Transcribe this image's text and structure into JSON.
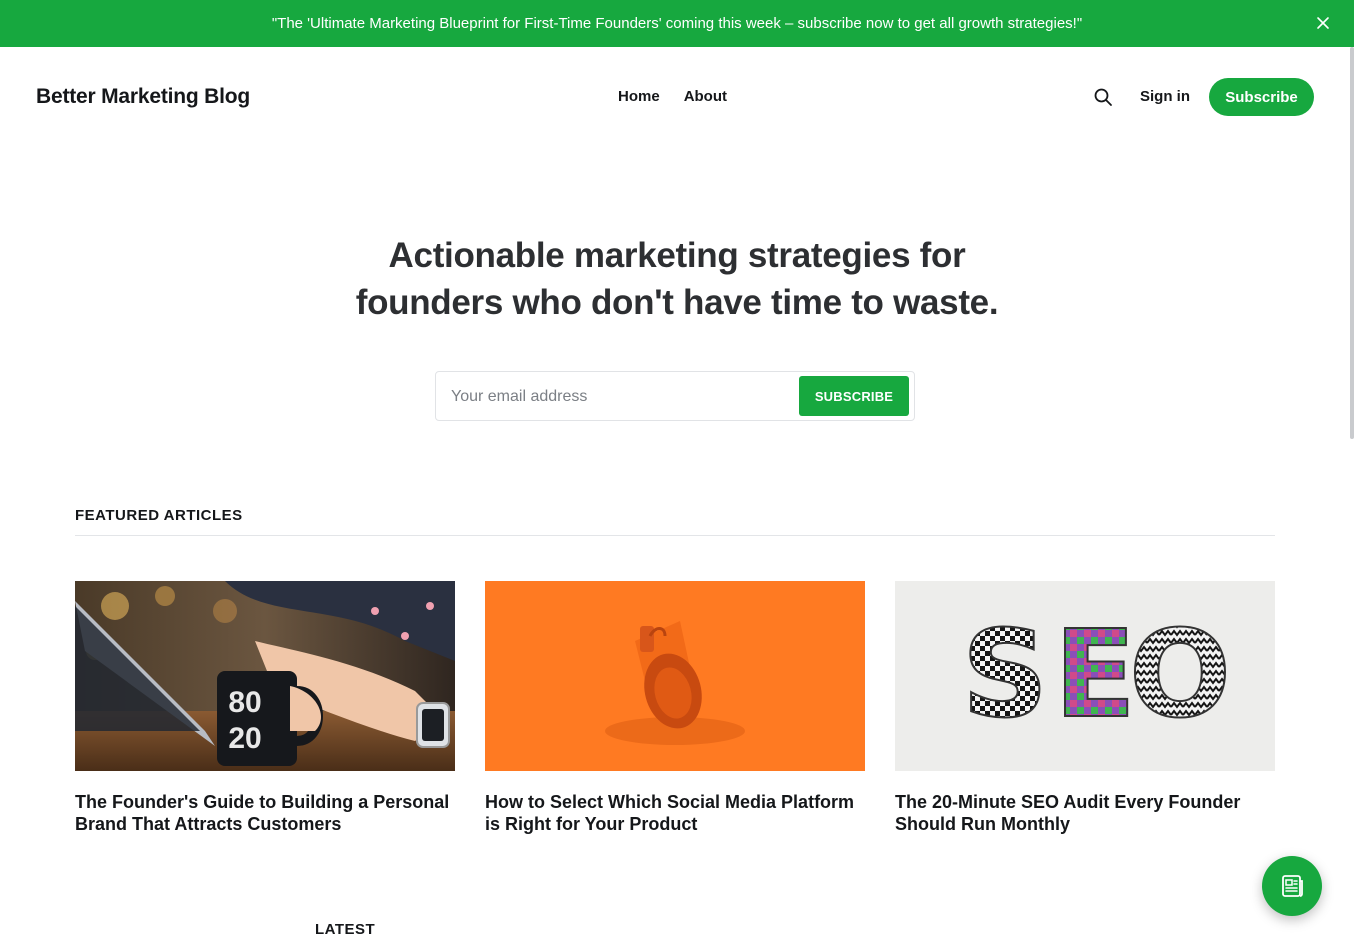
{
  "announcement": {
    "text": "\"The 'Ultimate Marketing Blueprint for First-Time Founders' coming this week – subscribe now to get all growth strategies!\"",
    "close_icon": "close-icon"
  },
  "header": {
    "logo": "Better Marketing Blog",
    "nav": [
      {
        "label": "Home"
      },
      {
        "label": "About"
      }
    ],
    "search_icon": "search-icon",
    "signin_label": "Sign in",
    "subscribe_label": "Subscribe"
  },
  "hero": {
    "title_line1": "Actionable marketing strategies for",
    "title_line2": "founders who don't have time to waste.",
    "email_placeholder": "Your email address",
    "email_value": "",
    "subscribe_label": "SUBSCRIBE"
  },
  "featured": {
    "heading": "FEATURED ARTICLES",
    "articles": [
      {
        "title": "The Founder's Guide to Building a Personal Brand That Attracts Customers",
        "image": "laptop-and-mug-photo",
        "mug_text_1": "80",
        "mug_text_2": "20"
      },
      {
        "title": "How to Select Which Social Media Platform is Right for Your Product",
        "image": "megaphone-on-orange-photo"
      },
      {
        "title": "The 20-Minute SEO Audit Every Founder Should Run Monthly",
        "image": "seo-letters-photo",
        "letters": "SEO"
      }
    ]
  },
  "latest": {
    "heading": "LATEST"
  },
  "fab": {
    "icon": "newspaper-icon"
  },
  "colors": {
    "accent": "#17a83f",
    "text": "#15171a",
    "hero_text": "#2d2f32",
    "orange": "#ff7a22"
  }
}
